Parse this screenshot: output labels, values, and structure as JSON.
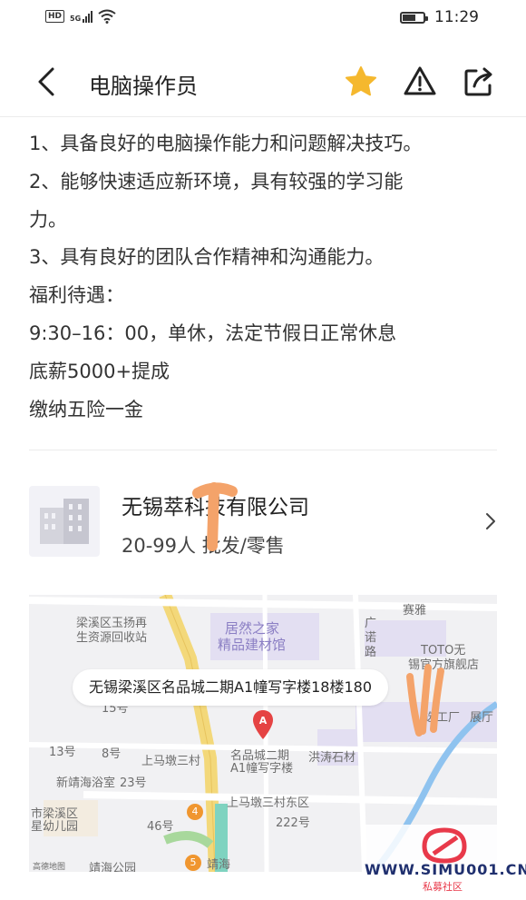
{
  "status_bar": {
    "network": "HD",
    "signal": "5G",
    "time": "11:29"
  },
  "header": {
    "title": "电脑操作员"
  },
  "description": {
    "lines": [
      "1、具备良好的电脑操作能力和问题解决技巧。",
      "2、能够快速适应新环境，具有较强的学习能",
      "力。",
      "3、具有良好的团队合作精神和沟通能力。",
      "福利待遇：",
      "9:30–16：00，单休，法定节假日正常休息",
      "底薪5000+提成",
      "缴纳五险一金"
    ]
  },
  "company": {
    "name": "无锡萃​科技有限公司",
    "size": "20-99人",
    "industry": "批发/零售",
    "meta": "20-99人   批发/零售"
  },
  "map": {
    "address": "无锡梁溪区名品城二期A1幢写字楼18楼180",
    "labels": {
      "l1": "梁溪区玉扬再",
      "l2": "生资源回收站",
      "l3": "居然之家",
      "l4": "精品建材馆",
      "l5": "赛雅",
      "l6": "TOTO无",
      "l7": "锡官方旗舰店",
      "l8": "名品城二期",
      "l9": "A1幢写字楼",
      "l10": "洪涛石材",
      "l11": "上马墩三村",
      "l12": "新靖海浴室",
      "l13": "上马墩三村东区",
      "l14": "市梁溪区",
      "l15": "星幼儿园",
      "l16": "靖海公园",
      "l17": "靖海",
      "l18": "222号",
      "l19": "46号",
      "l20": "23号",
      "l21": "13号",
      "l22": "8号",
      "l23": "15号",
      "l24": "广",
      "l25": "诺",
      "l26": "路",
      "l27": "展厅",
      "l28": "选工厂",
      "l29": "4",
      "l30": "5",
      "l31": "高德地图"
    }
  },
  "watermark": {
    "site": "WWW.SIMU001.CN",
    "sub": "私募社区"
  },
  "colors": {
    "star": "#f5b82e",
    "text": "#333333",
    "map_road": "#f3d87a"
  }
}
